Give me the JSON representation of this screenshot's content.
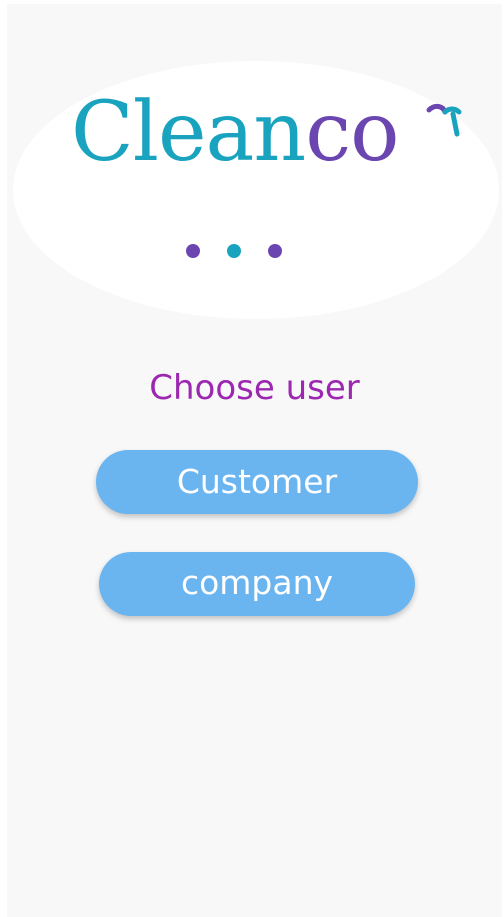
{
  "logo": {
    "text_primary": "Clean",
    "text_secondary": "co",
    "mark_icon": "leaf-sprout-icon",
    "colors": {
      "primary": "#1aa3bf",
      "secondary": "#6b46b0"
    }
  },
  "loading_dots": {
    "icon": "three-dots-icon",
    "colors": [
      "#6b46b0",
      "#1aa3bf",
      "#6b46b0"
    ]
  },
  "prompt": {
    "label": "Choose user",
    "color": "#9c27b0"
  },
  "buttons": {
    "customer_label": "Customer",
    "company_label": "company",
    "color": "#6ab4f0"
  }
}
